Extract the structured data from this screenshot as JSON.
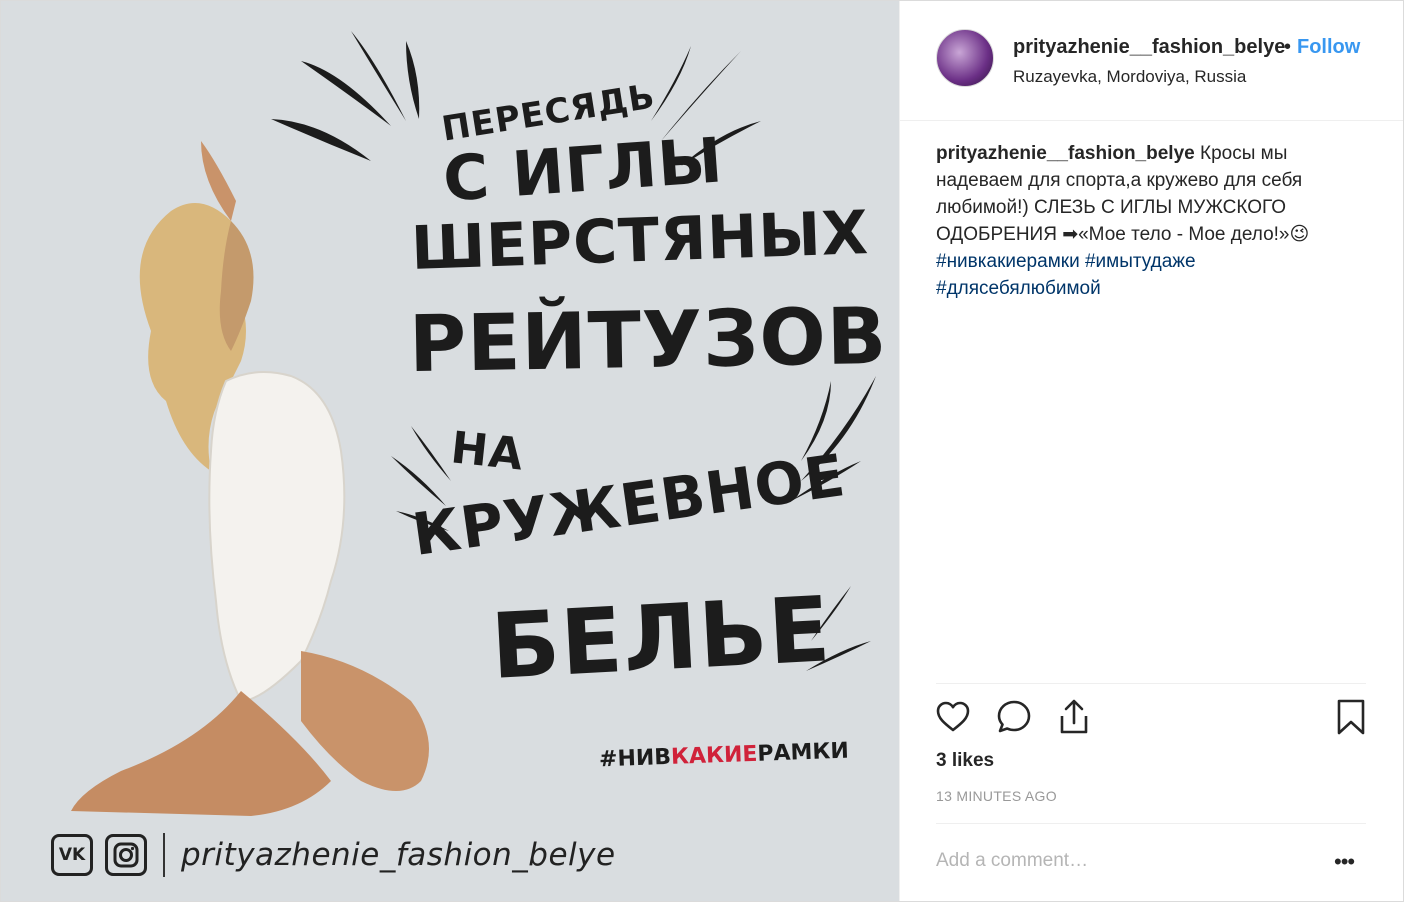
{
  "post": {
    "image": {
      "lettering": {
        "line1": "ПЕРЕСЯДЬ",
        "line2": "С ИГЛЫ",
        "line3": "ШЕРСТЯНЫХ",
        "line4": "РЕЙТУЗОВ",
        "line5": "НА",
        "line6": "КРУЖЕВНОЕ",
        "line7": "БЕЛЬЕ"
      },
      "hashtag": {
        "prefix": "#НИВ",
        "highlight": "КАКИЕ",
        "suffix": "РАМКИ"
      },
      "brand_handle": "prityazhenie_fashion_belye",
      "vk_label": "VK",
      "colors": {
        "background": "#d9dde0",
        "ink": "#1c1c1c",
        "accent": "#d0223a"
      }
    },
    "header": {
      "username": "prityazhenie__fashion_belye",
      "separator": "•",
      "follow_label": "Follow",
      "location": "Ruzayevka, Mordoviya, Russia"
    },
    "caption": {
      "username": "prityazhenie__fashion_belye",
      "text": " Кросы мы надеваем для спорта,а кружево для себя любимой!) СЛЕЗЬ С ИГЛЫ МУЖСКОГО ОДОБРЕНИЯ ➡«Мое тело - Мое дело!»",
      "emoji": "😉",
      "hashtags": [
        "#нивкакиерамки",
        "#имытудаже",
        "#длясебялюбимой"
      ]
    },
    "actions": {
      "icons": [
        "heart-icon",
        "comment-icon",
        "share-icon",
        "bookmark-icon"
      ]
    },
    "likes": "3 likes",
    "timestamp": "13 MINUTES AGO",
    "comment": {
      "placeholder": "Add a comment…",
      "more_label": "•••"
    },
    "ui_colors": {
      "link": "#3897f0",
      "hashtag": "#003569",
      "muted": "#999999"
    }
  }
}
